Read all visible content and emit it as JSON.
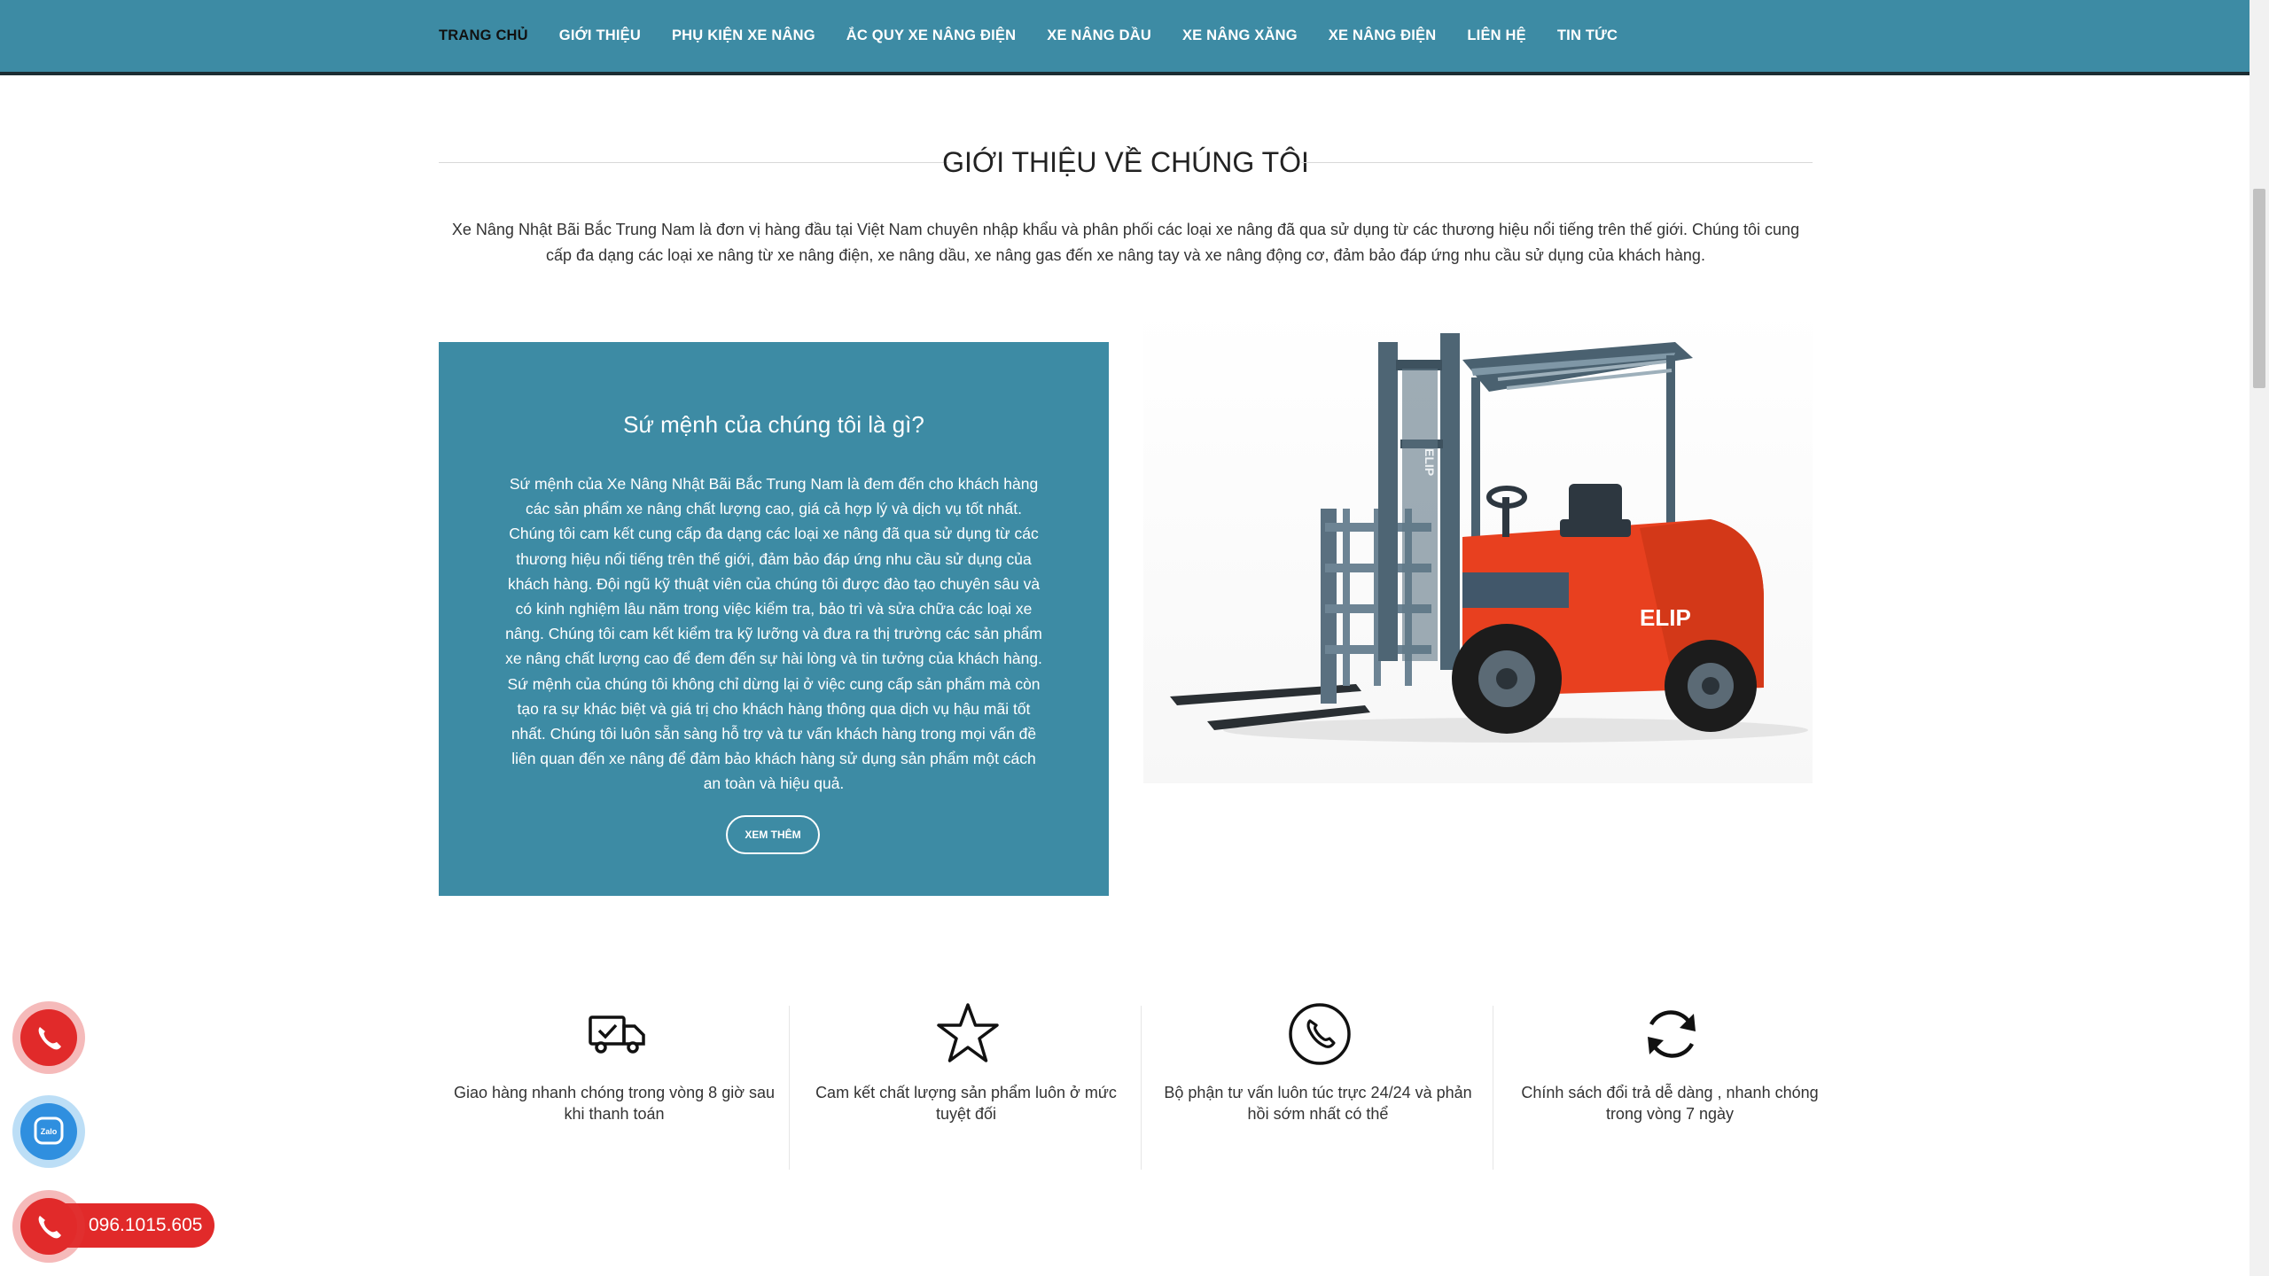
{
  "nav": {
    "items": [
      {
        "label": "TRANG CHỦ",
        "active": true
      },
      {
        "label": "GIỚI THIỆU"
      },
      {
        "label": "PHỤ KIỆN XE NÂNG"
      },
      {
        "label": "ẮC QUY XE NÂNG ĐIỆN"
      },
      {
        "label": "XE NÂNG DẦU"
      },
      {
        "label": "XE NÂNG XĂNG"
      },
      {
        "label": "XE NÂNG ĐIỆN"
      },
      {
        "label": "LIÊN HỆ"
      },
      {
        "label": "TIN TỨC"
      }
    ]
  },
  "about": {
    "title": "GIỚI THIỆU VỀ CHÚNG TÔI",
    "intro": "Xe Nâng Nhật Bãi Bắc Trung Nam là đơn vị hàng đầu tại Việt Nam chuyên nhập khẩu và phân phối các loại xe nâng đã qua sử dụng từ các thương hiệu nổi tiếng trên thế giới. Chúng tôi cung cấp đa dạng các loại xe nâng từ xe nâng điện, xe nâng dầu, xe nâng gas đến xe nâng tay và xe nâng động cơ, đảm bảo đáp ứng nhu cầu sử dụng của khách hàng."
  },
  "mission": {
    "heading": "Sứ mệnh của chúng tôi là gì?",
    "body": "Sứ mệnh của Xe Nâng Nhật Bãi Bắc Trung Nam là đem đến cho khách hàng các sản phẩm xe nâng chất lượng cao, giá cả hợp lý và dịch vụ tốt nhất. Chúng tôi cam kết cung cấp đa dạng các loại xe nâng đã qua sử dụng từ các thương hiệu nổi tiếng trên thế giới, đảm bảo đáp ứng nhu cầu sử dụng của khách hàng. Đội ngũ kỹ thuật viên của chúng tôi được đào tạo chuyên sâu và có kinh nghiệm lâu năm trong việc kiểm tra, bảo trì và sửa chữa các loại xe nâng. Chúng tôi cam kết kiểm tra kỹ lưỡng và đưa ra thị trường các sản phẩm xe nâng chất lượng cao để đem đến sự hài lòng và tin tưởng của khách hàng. Sứ mệnh của chúng tôi không chỉ dừng lại ở việc cung cấp sản phẩm mà còn tạo ra sự khác biệt và giá trị cho khách hàng thông qua dịch vụ hậu mãi tốt nhất. Chúng tôi luôn sẵn sàng hỗ trợ và tư vấn khách hàng trong mọi vấn đề liên quan đến xe nâng để đảm bảo khách hàng sử dụng sản phẩm một cách an toàn và hiệu quả.",
    "button": "XEM THÊM"
  },
  "product_image": {
    "brand_label": "ELIP",
    "colors": {
      "body": "#e8401f",
      "mast": "#5a7080",
      "tire": "#1c1c1c"
    }
  },
  "features": [
    {
      "icon": "delivery-truck-icon",
      "text": "Giao hàng nhanh chóng trong vòng 8 giờ sau khi thanh toán"
    },
    {
      "icon": "star-icon",
      "text": "Cam kết chất lượng sản phẩm luôn ở mức tuyệt đối"
    },
    {
      "icon": "phone-icon",
      "text": "Bộ phận tư vấn luôn túc trực 24/24 và phản hồi sớm nhất có thể"
    },
    {
      "icon": "refresh-icon",
      "text": "Chính sách đổi trả dễ dàng , nhanh chóng trong vòng 7 ngày"
    }
  ],
  "contact": {
    "hotline": "096.1015.605",
    "zalo_label": "Zalo"
  },
  "colors": {
    "primary": "#3d8ba4",
    "nav_border": "#1c2d33",
    "accent_red": "#e12a2a",
    "zalo_blue": "#2f8fdf"
  }
}
